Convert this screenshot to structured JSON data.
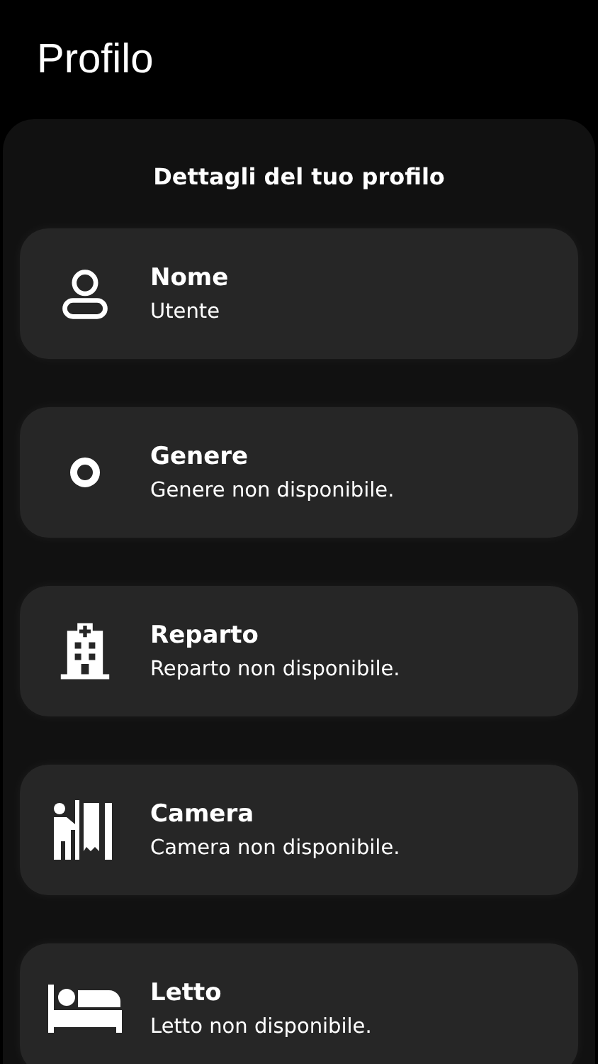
{
  "header": {
    "title": "Profilo"
  },
  "panel": {
    "heading": "Dettagli del tuo profilo",
    "items": [
      {
        "kind": "person",
        "label": "Nome",
        "value": "Utente"
      },
      {
        "kind": "ring",
        "label": "Genere",
        "value": "Genere non disponibile."
      },
      {
        "kind": "hospital",
        "label": "Reparto",
        "value": "Reparto non disponibile."
      },
      {
        "kind": "room",
        "label": "Camera",
        "value": "Camera non disponibile."
      },
      {
        "kind": "bed",
        "label": "Letto",
        "value": "Letto non disponibile."
      }
    ]
  }
}
